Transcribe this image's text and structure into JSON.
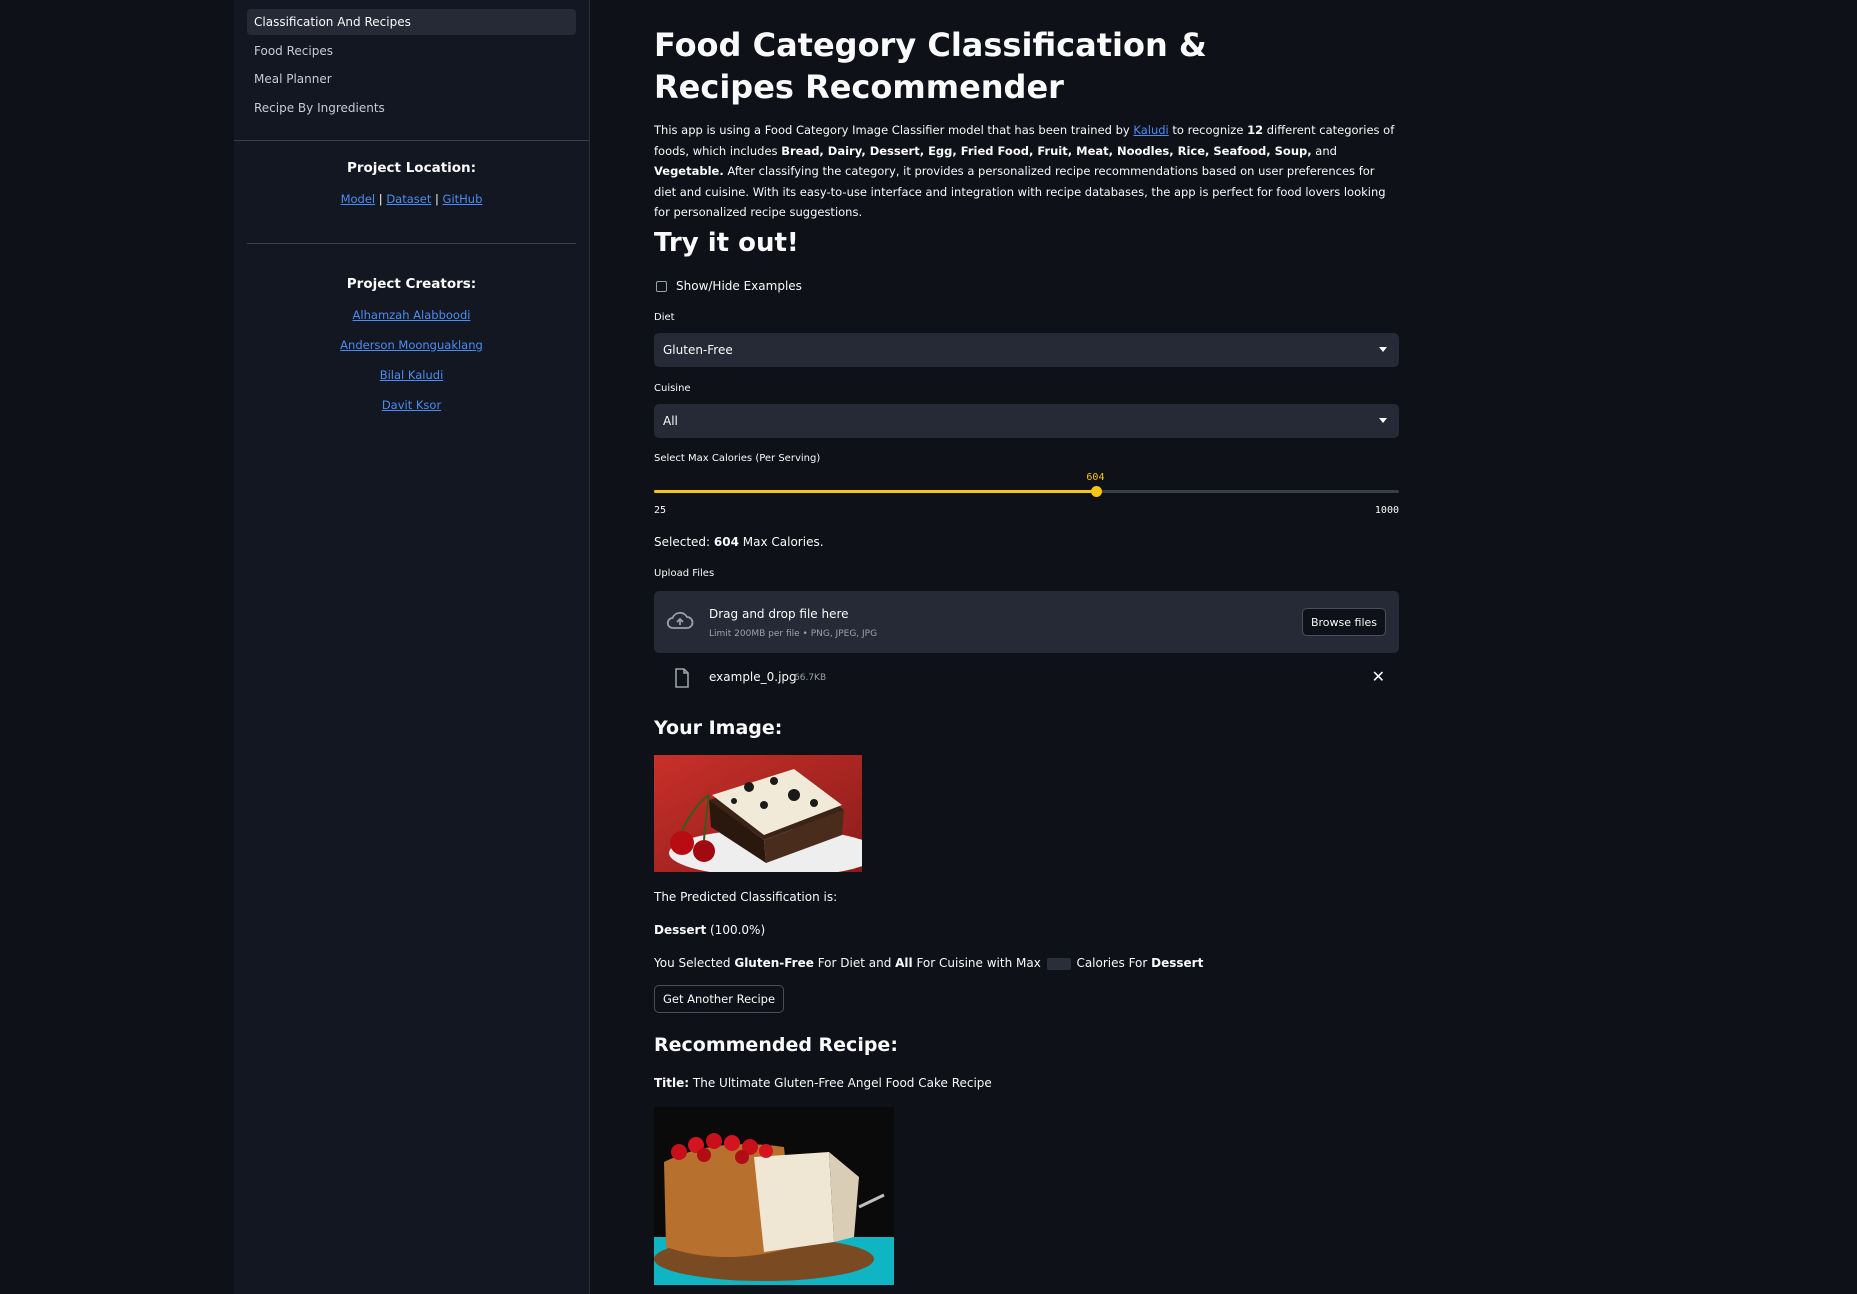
{
  "sidebar": {
    "nav": [
      {
        "label": "Classification And Recipes",
        "active": true
      },
      {
        "label": "Food Recipes",
        "active": false
      },
      {
        "label": "Meal Planner",
        "active": false
      },
      {
        "label": "Recipe By Ingredients",
        "active": false
      }
    ],
    "project_location": {
      "heading": "Project Location:",
      "links": [
        "Model",
        "Dataset",
        "GitHub"
      ],
      "divider": "|"
    },
    "project_creators": {
      "heading": "Project Creators:",
      "names": [
        "Alhamzah Alabboodi",
        "Anderson Moonguaklang",
        "Bilal Kaludi",
        "Davit Ksor"
      ]
    }
  },
  "main": {
    "title": "Food Category Classification & Recipes Recommender",
    "description": {
      "p1": "This app is using a Food Category Image Classifier model that has been trained by ",
      "link": "Kaludi",
      "p2": " to recognize ",
      "count": "12",
      "p3": " different categories of foods, which includes ",
      "categories": "Bread, Dairy, Dessert, Egg, Fried Food, Fruit, Meat, Noodles, Rice, Seafood, Soup,",
      "p4": " and ",
      "last_category": "Vegetable.",
      "p5": " After classifying the category, it provides a personalized recipe recommendations based on user preferences for diet and cuisine. With its easy-to-use interface and integration with recipe databases, the app is perfect for food lovers looking for personalized recipe suggestions."
    },
    "try_heading": "Try it out!",
    "examples_checkbox": "Show/Hide Examples",
    "diet": {
      "label": "Diet",
      "value": "Gluten-Free"
    },
    "cuisine": {
      "label": "Cuisine",
      "value": "All"
    },
    "calories": {
      "label": "Select Max Calories (Per Serving)",
      "value": 604,
      "min": 25,
      "max": 1000,
      "selected_prefix": "Selected: ",
      "selected_value": "604",
      "selected_suffix": " Max Calories."
    },
    "upload": {
      "label": "Upload Files",
      "drop_title": "Drag and drop file here",
      "drop_sub": "Limit 200MB per file • PNG, JPEG, JPG",
      "browse_label": "Browse files",
      "file_name": "example_0.jpg",
      "file_size": "66.7KB",
      "close_glyph": "✕"
    },
    "your_image_heading": "Your Image:",
    "prediction_label": "The Predicted Classification is:",
    "prediction_class": "Dessert",
    "prediction_conf": " (100.0%)",
    "selection_summary": {
      "t1": "You Selected ",
      "diet": "Gluten-Free",
      "t2": " For Diet and ",
      "cuisine": "All",
      "t3": " For Cuisine with Max ",
      "t4": " Calories For ",
      "category": "Dessert"
    },
    "another_button": "Get Another Recipe",
    "recommended_heading": "Recommended Recipe:",
    "recipe_title_label": "Title:",
    "recipe_title": " The Ultimate Gluten-Free Angel Food Cake Recipe"
  },
  "colors": {
    "accent": "#f5c518",
    "link": "#4b8cf5",
    "background": "#0e1117",
    "sidebar": "#131721",
    "input": "#262a36"
  }
}
